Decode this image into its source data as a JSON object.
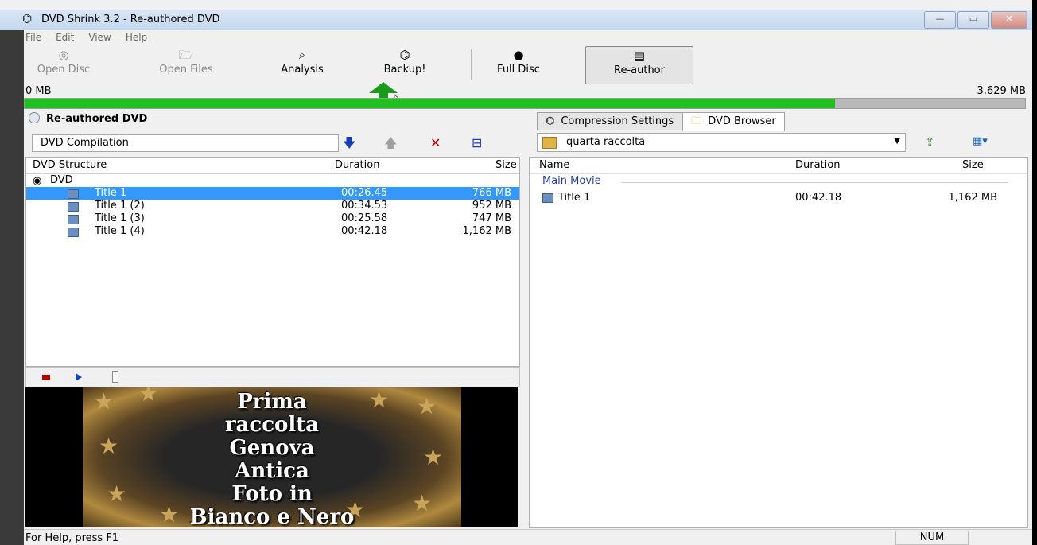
{
  "window": {
    "title": "DVD Shrink 3.2 - Re-authored DVD",
    "app_icon": "dvdshrink-icon",
    "buttons": {
      "minimize": "—",
      "maximize": "▭",
      "close": "✕"
    }
  },
  "menu": [
    "File",
    "Edit",
    "View",
    "Help"
  ],
  "toolbar": {
    "open_disc": "Open Disc",
    "open_files": "Open Files",
    "analysis": "Analysis",
    "backup": "Backup!",
    "full_disc": "Full Disc",
    "re_author": "Re-author"
  },
  "sizebar": {
    "left_label": "0 MB",
    "right_label": "3,629 MB",
    "fill_fraction": 0.81,
    "fill_color": "#20c020"
  },
  "left": {
    "panel_title": "Re-authored DVD",
    "compilation_name": "DVD Compilation",
    "columns": {
      "structure": "DVD Structure",
      "duration": "Duration",
      "size": "Size"
    },
    "root": "DVD",
    "rows": [
      {
        "name": "Title 1",
        "duration": "00:26.45",
        "size": "766 MB",
        "selected": true
      },
      {
        "name": "Title 1 (2)",
        "duration": "00:34.53",
        "size": "952 MB",
        "selected": false
      },
      {
        "name": "Title 1 (3)",
        "duration": "00:25.58",
        "size": "747 MB",
        "selected": false
      },
      {
        "name": "Title 1 (4)",
        "duration": "00:42.18",
        "size": "1,162 MB",
        "selected": false
      }
    ],
    "preview_text_lines": [
      "Prima",
      "raccolta",
      "Genova",
      "Antica",
      "Foto in",
      "Bianco e Nero"
    ]
  },
  "right": {
    "tabs": [
      {
        "label": "Compression Settings",
        "icon": "compression-icon",
        "active": false
      },
      {
        "label": "DVD Browser",
        "icon": "folder-icon",
        "active": true
      }
    ],
    "folder": "quarta raccolta",
    "columns": {
      "name": "Name",
      "duration": "Duration",
      "size": "Size"
    },
    "group": "Main Movie",
    "rows": [
      {
        "name": "Title 1",
        "duration": "00:42.18",
        "size": "1,162 MB"
      }
    ]
  },
  "status": {
    "help": "For Help, press F1",
    "num": "NUM"
  }
}
